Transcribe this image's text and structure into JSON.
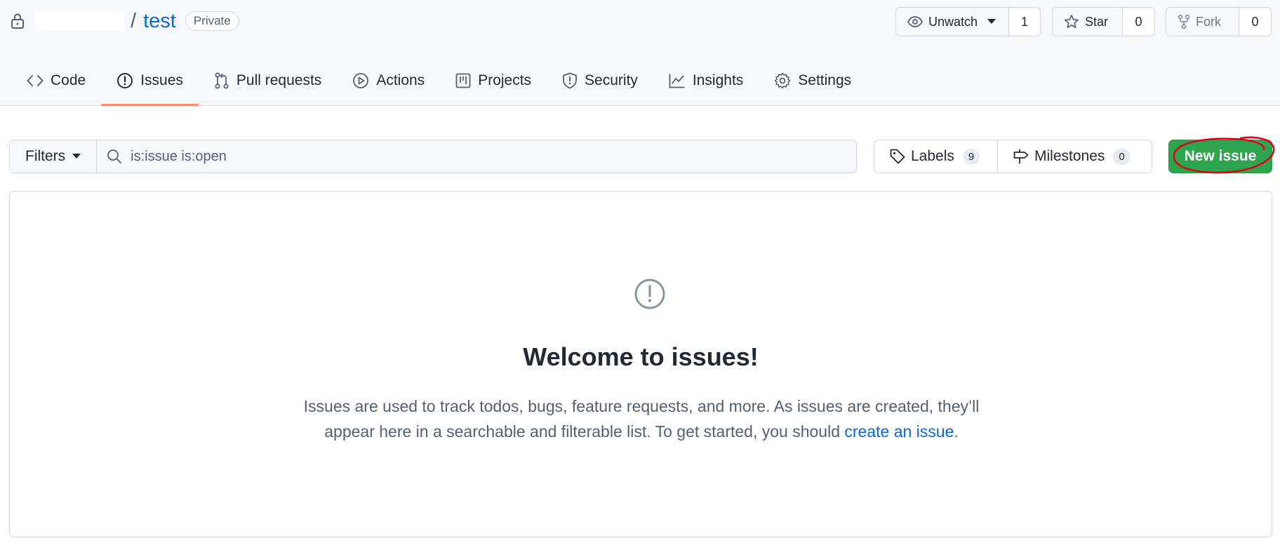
{
  "repo": {
    "name": "test",
    "separator": "/",
    "visibility": "Private"
  },
  "actions": {
    "watch": {
      "label": "Unwatch",
      "count": "1"
    },
    "star": {
      "label": "Star",
      "count": "0"
    },
    "fork": {
      "label": "Fork",
      "count": "0"
    }
  },
  "tabs": [
    {
      "label": "Code",
      "icon": "code-icon"
    },
    {
      "label": "Issues",
      "icon": "issue-opened-icon",
      "selected": true
    },
    {
      "label": "Pull requests",
      "icon": "git-pull-request-icon"
    },
    {
      "label": "Actions",
      "icon": "play-icon"
    },
    {
      "label": "Projects",
      "icon": "table-icon"
    },
    {
      "label": "Security",
      "icon": "shield-icon"
    },
    {
      "label": "Insights",
      "icon": "graph-icon"
    },
    {
      "label": "Settings",
      "icon": "gear-icon"
    }
  ],
  "subnav": {
    "filters_label": "Filters",
    "search_value": "is:issue is:open",
    "labels": {
      "label": "Labels",
      "count": "9"
    },
    "milestones": {
      "label": "Milestones",
      "count": "0"
    },
    "new_issue_label": "New issue"
  },
  "blankslate": {
    "title": "Welcome to issues!",
    "text_before": "Issues are used to track todos, bugs, feature requests, and more. As issues are created, they’ll appear here in a searchable and filterable list. To get started, you should ",
    "link": "create an issue",
    "text_after": "."
  },
  "colors": {
    "accent_link": "#0969da",
    "primary_button": "#2da44e",
    "selected_tab_underline": "#fd8c73",
    "annotation": "#e0001a"
  }
}
